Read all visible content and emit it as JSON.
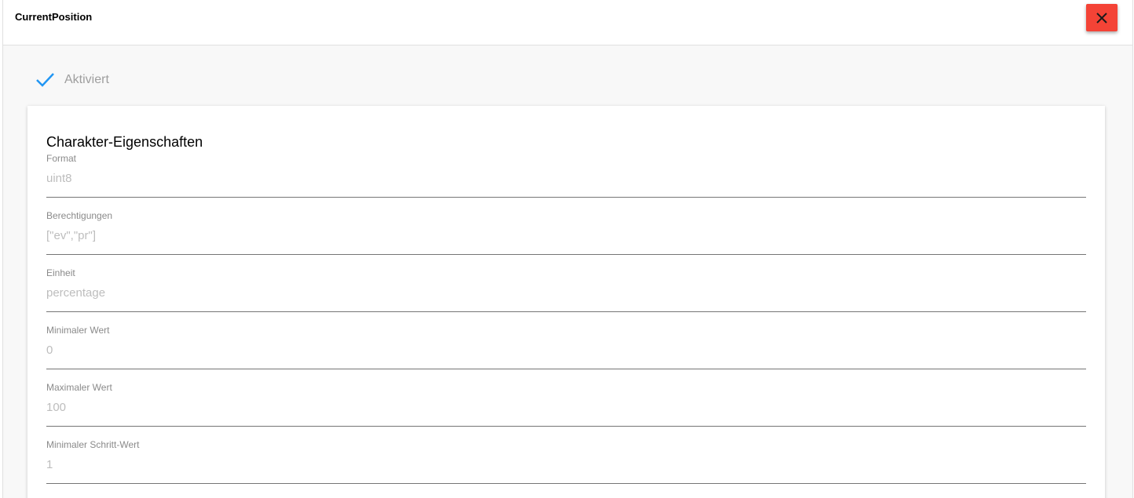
{
  "header": {
    "title": "CurrentPosition",
    "close_icon": "close-icon"
  },
  "enabled": {
    "icon": "checkmark-icon",
    "label": "Aktiviert",
    "checked": true,
    "accent_color": "#2196f3"
  },
  "card": {
    "title": "Charakter-Eigenschaften",
    "fields": [
      {
        "label": "Format",
        "value": "uint8"
      },
      {
        "label": "Berechtigungen",
        "value": "[\"ev\",\"pr\"]"
      },
      {
        "label": "Einheit",
        "value": "percentage"
      },
      {
        "label": "Minimaler Wert",
        "value": "0"
      },
      {
        "label": "Maximaler Wert",
        "value": "100"
      },
      {
        "label": "Minimaler Schritt-Wert",
        "value": "1"
      }
    ]
  },
  "colors": {
    "close_button": "#f44336"
  }
}
